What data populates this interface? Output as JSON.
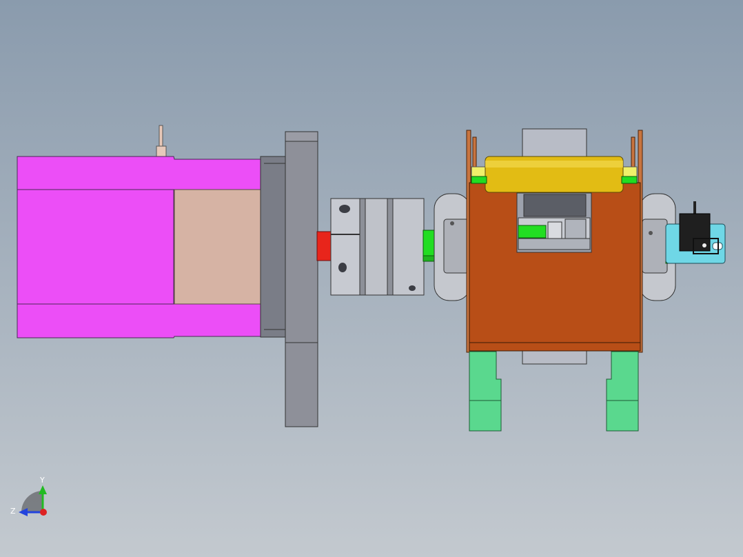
{
  "viewport": {
    "background_top": "#8a9bad",
    "background_bottom": "#c3c9cf"
  },
  "triad": {
    "y_label": "Y",
    "z_label": "Z",
    "y_color": "#22bb22",
    "z_color": "#2244dd",
    "x_color": "#dd2222"
  },
  "parts": [
    {
      "name": "motor-housing",
      "color": "#ec4ef7"
    },
    {
      "name": "motor-end-cap",
      "color": "#d6b3a4"
    },
    {
      "name": "motor-flange",
      "color": "#7a7d87"
    },
    {
      "name": "mounting-plate",
      "color": "#8e9099"
    },
    {
      "name": "motor-shaft",
      "color": "#e8251b"
    },
    {
      "name": "flexible-coupling",
      "color": "#b9bcc4"
    },
    {
      "name": "green-shaft",
      "color": "#22dd22"
    },
    {
      "name": "gearbox-body",
      "color": "#b84e17"
    },
    {
      "name": "roller",
      "color": "#e2bc14"
    },
    {
      "name": "support-feet",
      "color": "#5ad88e"
    },
    {
      "name": "sensor-bracket",
      "color": "#6fd7e6"
    },
    {
      "name": "sensor-block",
      "color": "#1f1f1f"
    }
  ]
}
